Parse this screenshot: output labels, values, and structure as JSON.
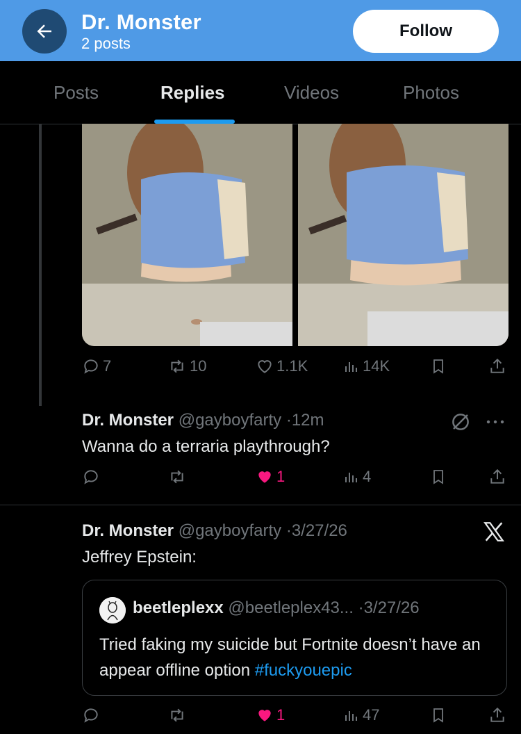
{
  "header": {
    "back_icon": "arrow-left-icon",
    "title": "Dr. Monster",
    "subtitle": "2 posts",
    "follow_label": "Follow",
    "bg_color": "#4f9ae6"
  },
  "tabs": [
    {
      "label": "Posts",
      "active": false
    },
    {
      "label": "Replies",
      "active": true
    },
    {
      "label": "Videos",
      "active": false
    },
    {
      "label": "Photos",
      "active": false
    }
  ],
  "accent_color": "#1d9bf0",
  "like_color": "#f91880",
  "post1": {
    "media_count": 2,
    "actions": {
      "replies": "7",
      "reposts": "10",
      "likes": "1.1K",
      "views": "14K"
    }
  },
  "post2": {
    "name": "Dr. Monster",
    "handle": "@gayboyfarty",
    "time": "12m",
    "text": "Wanna do a terraria playthrough?",
    "actions": {
      "likes": "1",
      "liked": true,
      "views": "4"
    }
  },
  "post3": {
    "name": "Dr. Monster",
    "handle": "@gayboyfarty",
    "time": "3/27/26",
    "text": "Jeffrey Epstein:",
    "quote": {
      "name": "beetleplexx",
      "handle": "@beetleplex43...",
      "time": "3/27/26",
      "text": "Tried faking my suicide but Fortnite doesn’t have an appear offline option",
      "hashtag": "#fuckyouepic"
    },
    "actions": {
      "likes": "1",
      "liked": true,
      "views": "47"
    }
  }
}
